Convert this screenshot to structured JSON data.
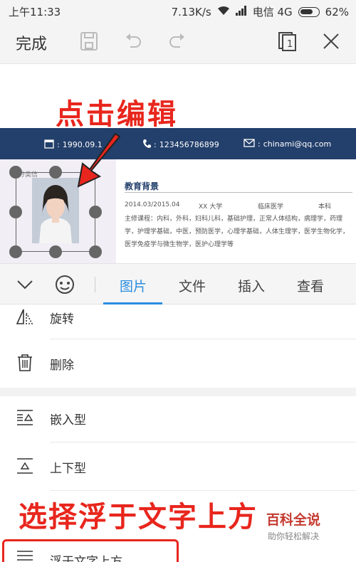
{
  "status_bar": {
    "time": "上午11:33",
    "speed": "7.13K/s",
    "carrier": "电信 4G",
    "battery": "62%"
  },
  "toolbar": {
    "done_label": "完成"
  },
  "document": {
    "banner": {
      "birth": "1990.09.1",
      "phone": "123456786899",
      "email": "chinami@qq.com"
    },
    "side_label": "分类信",
    "education_title": "教育背景",
    "education_row": {
      "period": "2014.03/2015.04",
      "school": "XX 大学",
      "major": "临床医学",
      "degree": "本科"
    },
    "education_desc": "主修课程：内科，外科，妇科儿科，基础护理，正常人体结构，病理学，药理学，护理学基础，中医，预防医学，心理学基础，人体生理学，医学生物化学，医学免疫学与微生物学，医护心理学等"
  },
  "annotations": {
    "top": "点击编辑",
    "bottom": "选择浮于文字上方"
  },
  "tabs": [
    {
      "label": "图片",
      "active": true
    },
    {
      "label": "文件",
      "active": false
    },
    {
      "label": "插入",
      "active": false
    },
    {
      "label": "查看",
      "active": false
    }
  ],
  "menu": {
    "rotate": "旋转",
    "delete": "删除",
    "inline": "嵌入型",
    "top_bottom": "上下型",
    "float_above": "浮于文字上方"
  },
  "watermark": {
    "title": "百科全说",
    "subtitle": "助你轻松解决"
  },
  "colors": {
    "accent": "#2a8de0",
    "annotation": "#e8261d",
    "banner": "#233f6b"
  }
}
